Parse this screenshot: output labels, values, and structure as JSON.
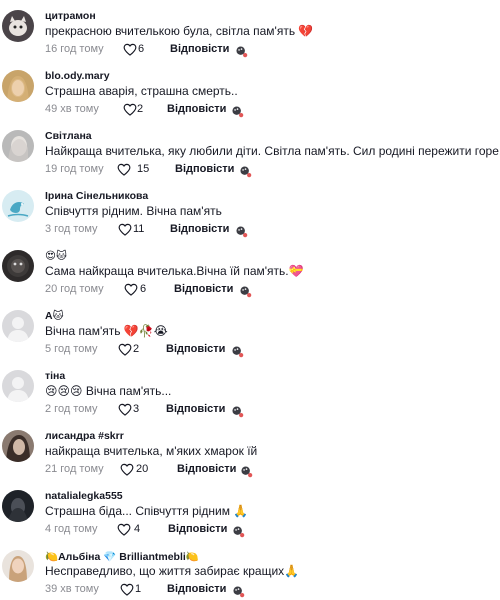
{
  "comments": [
    {
      "username": "цитрамон",
      "text": "прекрасною вчителькою була, світла пам'ять 💔",
      "time": "16 год тому",
      "likes": "6",
      "reply": "Відповісти",
      "avatar": "dark-cat"
    },
    {
      "username": "blo.ody.mary",
      "text": "Страшна аварія, страшна смерть..",
      "time": "49 хв тому",
      "likes": "2",
      "reply": "Відповісти",
      "avatar": "blonde"
    },
    {
      "username": "Світлана",
      "text": "Найкраща вчителька, яку любили діти. Світла пам'ять. Сил родині пережити горе.",
      "time": "19 год тому",
      "likes": "15",
      "reply": "Відповісти",
      "avatar": "portrait"
    },
    {
      "username": "Ірина Сінельникова",
      "text": "Співчуття рідним. Вічна пам'ять",
      "time": "3 год тому",
      "likes": "11",
      "reply": "Відповісти",
      "avatar": "bird"
    },
    {
      "username": "😍🐱",
      "text": "Сама найкраща вчителька.Вічна їй пам'ять.💝",
      "time": "20 год тому",
      "likes": "6",
      "reply": "Відповісти",
      "avatar": "dark-round"
    },
    {
      "username": "A🐱",
      "text": "Вічна пам'ять 💔🥀😭",
      "time": "5 год тому",
      "likes": "2",
      "reply": "Відповісти",
      "avatar": "default"
    },
    {
      "username": "тіна",
      "text": "😢😢😢 Вічна пам'ять...",
      "time": "2 год тому",
      "likes": "3",
      "reply": "Відповісти",
      "avatar": "default"
    },
    {
      "username": "лисандра #skrr",
      "text": "найкраща вчителька, м'яких хмарок їй",
      "time": "21 год тому",
      "likes": "20",
      "reply": "Відповісти",
      "avatar": "hair"
    },
    {
      "username": "natalialegka555",
      "text": "Страшна біда... Співчуття рідним 🙏",
      "time": "4 год тому",
      "likes": "4",
      "reply": "Відповісти",
      "avatar": "night"
    },
    {
      "username": "🍋Альбіна 💎 Brilliantmebli🍋",
      "text": "Несправедливо, що життя забирає кращих🙏",
      "time": "39 хв тому",
      "likes": "1",
      "reply": "Відповісти",
      "avatar": "woman"
    }
  ],
  "colors": {
    "meta": "#8a8b91",
    "text": "#161823",
    "avatar_default": "#d9d9dc"
  },
  "icons": {
    "like": "heart-outline-icon",
    "more": "options-icon"
  }
}
